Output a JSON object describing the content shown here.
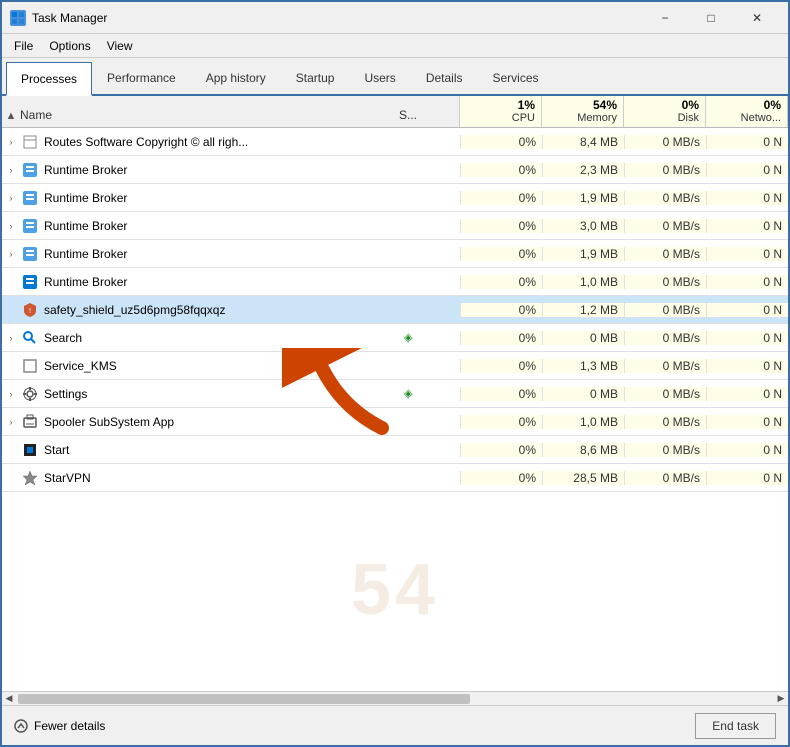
{
  "window": {
    "title": "Task Manager",
    "icon": "TM"
  },
  "menu": {
    "items": [
      "File",
      "Options",
      "View"
    ]
  },
  "tabs": [
    {
      "id": "processes",
      "label": "Processes",
      "active": true
    },
    {
      "id": "performance",
      "label": "Performance",
      "active": false
    },
    {
      "id": "app-history",
      "label": "App history",
      "active": false
    },
    {
      "id": "startup",
      "label": "Startup",
      "active": false
    },
    {
      "id": "users",
      "label": "Users",
      "active": false
    },
    {
      "id": "details",
      "label": "Details",
      "active": false
    },
    {
      "id": "services",
      "label": "Services",
      "active": false
    }
  ],
  "columns": {
    "sort_arrow": "▲",
    "name": "Name",
    "status": "S...",
    "cpu": {
      "pct": "1%",
      "label": "CPU"
    },
    "memory": {
      "pct": "54%",
      "label": "Memory"
    },
    "disk": {
      "pct": "0%",
      "label": "Disk"
    },
    "network": {
      "pct": "0%",
      "label": "Netwo..."
    }
  },
  "rows": [
    {
      "name": "Routes Software Copyright © all righ...",
      "status": "",
      "cpu": "0%",
      "memory": "8,4 MB",
      "disk": "0 MB/s",
      "network": "0 N",
      "icon": "doc",
      "expand": true,
      "selected": false
    },
    {
      "name": "Runtime Broker",
      "status": "",
      "cpu": "0%",
      "memory": "2,3 MB",
      "disk": "0 MB/s",
      "network": "0 N",
      "icon": "blue",
      "expand": true,
      "selected": false
    },
    {
      "name": "Runtime Broker",
      "status": "",
      "cpu": "0%",
      "memory": "1,9 MB",
      "disk": "0 MB/s",
      "network": "0 N",
      "icon": "blue",
      "expand": true,
      "selected": false
    },
    {
      "name": "Runtime Broker",
      "status": "",
      "cpu": "0%",
      "memory": "3,0 MB",
      "disk": "0 MB/s",
      "network": "0 N",
      "icon": "blue",
      "expand": true,
      "selected": false
    },
    {
      "name": "Runtime Broker",
      "status": "",
      "cpu": "0%",
      "memory": "1,9 MB",
      "disk": "0 MB/s",
      "network": "0 N",
      "icon": "blue",
      "expand": true,
      "selected": false
    },
    {
      "name": "Runtime Broker",
      "status": "",
      "cpu": "0%",
      "memory": "1,0 MB",
      "disk": "0 MB/s",
      "network": "0 N",
      "icon": "blue-filled",
      "expand": false,
      "selected": false
    },
    {
      "name": "safety_shield_uz5d6pmg58fqqxqz",
      "status": "",
      "cpu": "0%",
      "memory": "1,2 MB",
      "disk": "0 MB/s",
      "network": "0 N",
      "icon": "shield",
      "expand": false,
      "selected": true
    },
    {
      "name": "Search",
      "status": "◈",
      "cpu": "0%",
      "memory": "0 MB",
      "disk": "0 MB/s",
      "network": "0 N",
      "icon": "search",
      "expand": true,
      "selected": false
    },
    {
      "name": "Service_KMS",
      "status": "",
      "cpu": "0%",
      "memory": "1,3 MB",
      "disk": "0 MB/s",
      "network": "0 N",
      "icon": "box",
      "expand": false,
      "selected": false
    },
    {
      "name": "Settings",
      "status": "◈",
      "cpu": "0%",
      "memory": "0 MB",
      "disk": "0 MB/s",
      "network": "0 N",
      "icon": "gear",
      "expand": true,
      "selected": false
    },
    {
      "name": "Spooler SubSystem App",
      "status": "",
      "cpu": "0%",
      "memory": "1,0 MB",
      "disk": "0 MB/s",
      "network": "0 N",
      "icon": "printer",
      "expand": true,
      "selected": false
    },
    {
      "name": "Start",
      "status": "",
      "cpu": "0%",
      "memory": "8,6 MB",
      "disk": "0 MB/s",
      "network": "0 N",
      "icon": "start",
      "expand": false,
      "selected": false
    },
    {
      "name": "StarVPN",
      "status": "",
      "cpu": "0%",
      "memory": "28,5 MB",
      "disk": "0 MB/s",
      "network": "0 N",
      "icon": "star",
      "expand": false,
      "selected": false
    }
  ],
  "footer": {
    "fewer_details": "Fewer details",
    "end_task": "End task"
  }
}
